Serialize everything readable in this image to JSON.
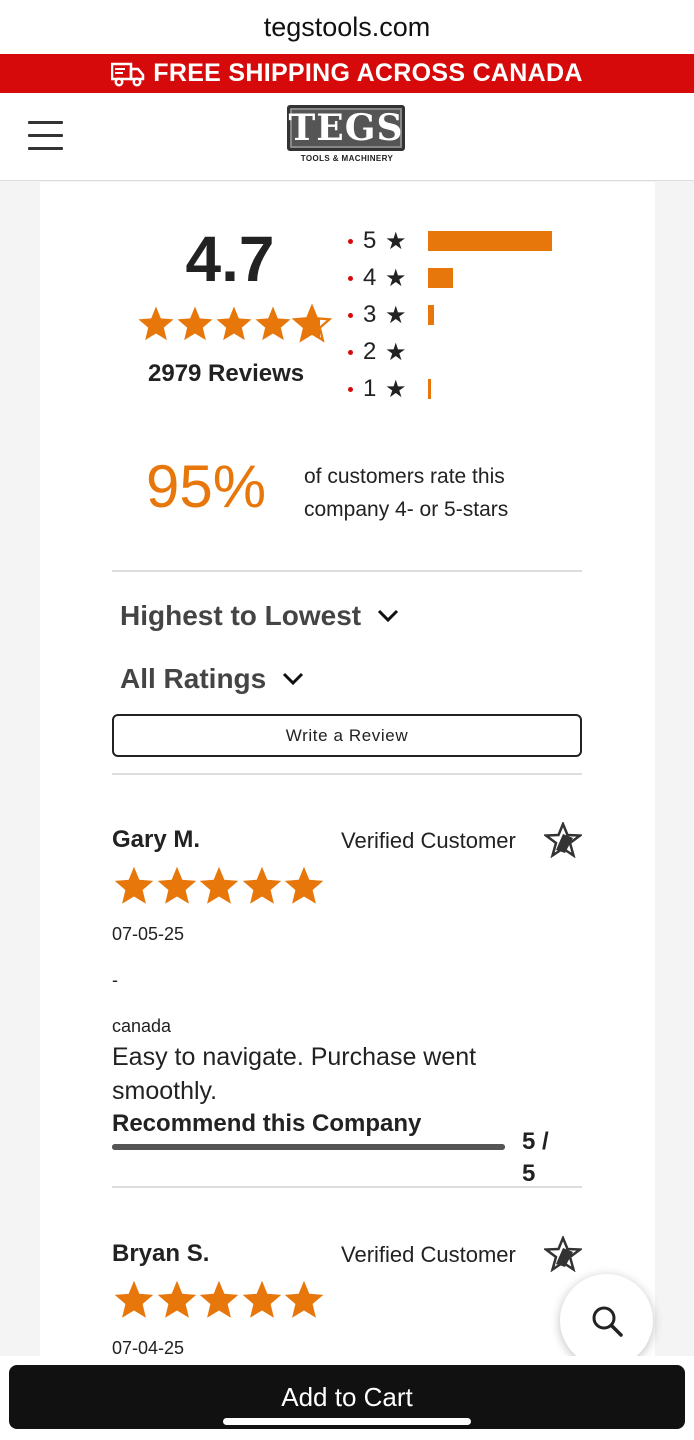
{
  "browser": {
    "url": "tegstools.com"
  },
  "promo_banner": {
    "text": "FREE SHIPPING ACROSS CANADA"
  },
  "header": {
    "logo_text": "TEGS",
    "logo_subtitle": "TOOLS & MACHINERY"
  },
  "summary": {
    "average": "4.7",
    "average_value": 4.7,
    "reviews_label": "2979 Reviews",
    "distribution": [
      {
        "stars": "5",
        "fraction": 0.85
      },
      {
        "stars": "4",
        "fraction": 0.17
      },
      {
        "stars": "3",
        "fraction": 0.04
      },
      {
        "stars": "2",
        "fraction": 0.0
      },
      {
        "stars": "1",
        "fraction": 0.015
      }
    ],
    "percent": "95%",
    "percent_text": "of customers rate this company 4- or 5-stars"
  },
  "controls": {
    "sort_label": "Highest to Lowest",
    "filter_label": "All Ratings",
    "write_review_label": "Write a Review"
  },
  "reviews": [
    {
      "name": "Gary M.",
      "verified": "Verified Customer",
      "rating": 5,
      "date": "07-05-25",
      "title": "-",
      "location": "canada",
      "body": "Easy to navigate. Purchase went smoothly.",
      "recommend_label": "Recommend this Company",
      "recommend_score": "5 / 5",
      "recommend_fraction": 1.0
    },
    {
      "name": "Bryan S.",
      "verified": "Verified Customer",
      "rating": 5,
      "date": "07-04-25"
    }
  ],
  "cart": {
    "label": "Add to Cart"
  },
  "icons": {
    "truck": "truck-icon",
    "menu": "hamburger-menu-icon",
    "star": "star-icon",
    "verified": "verified-star-badge-icon",
    "chevron": "chevron-down-icon",
    "search": "search-icon"
  },
  "colors": {
    "accent": "#e8770b",
    "promo": "#d60a0a",
    "cart": "#111111"
  }
}
